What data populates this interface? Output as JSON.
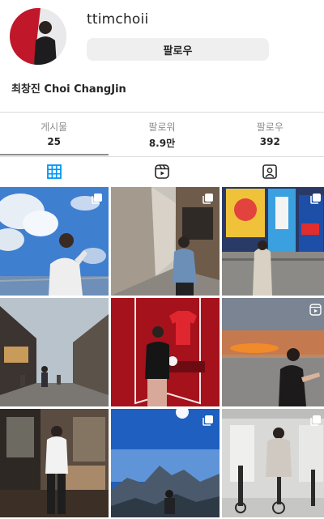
{
  "profile": {
    "username": "ttimchoii",
    "follow_label": "팔로우",
    "full_name": "최창진 Choi ChangJin"
  },
  "stats": [
    {
      "label": "게시물",
      "value": "25"
    },
    {
      "label": "팔로워",
      "value": "8.9만"
    },
    {
      "label": "팔로우",
      "value": "392"
    }
  ],
  "tabs": [
    {
      "icon": "grid-icon",
      "active": true
    },
    {
      "icon": "reels-icon",
      "active": false
    },
    {
      "icon": "tagged-icon",
      "active": false
    }
  ],
  "colors": {
    "accent": "#0095f6",
    "button_bg": "#efefef",
    "border": "#dbdbdb",
    "muted_text": "#8e8e8e"
  },
  "posts": [
    {
      "scene": "blue-sky-clouds",
      "badge": "carousel-icon"
    },
    {
      "scene": "alley-wall",
      "badge": "carousel-icon"
    },
    {
      "scene": "neon-signs",
      "badge": "carousel-icon"
    },
    {
      "scene": "old-street",
      "badge": "none"
    },
    {
      "scene": "red-room-jersey",
      "badge": "none"
    },
    {
      "scene": "sunset-sea",
      "badge": "reels-icon"
    },
    {
      "scene": "restaurant",
      "badge": "none"
    },
    {
      "scene": "mountain-sky",
      "badge": "carousel-icon"
    },
    {
      "scene": "gym",
      "badge": "carousel-icon"
    }
  ]
}
